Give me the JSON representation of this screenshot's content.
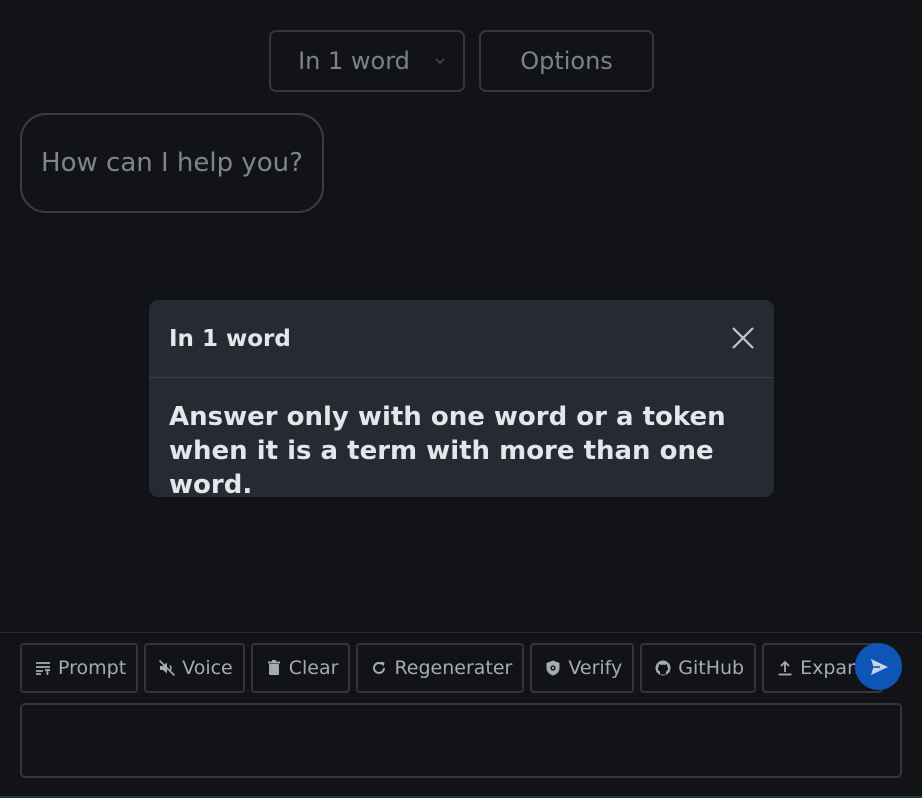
{
  "header": {
    "mode_select": {
      "value": "In 1 word"
    },
    "options_label": "Options"
  },
  "chat": {
    "greeting": "How can I help you?"
  },
  "modal": {
    "title": "In 1 word",
    "body": "Answer only with one word or a token when it is a term with more than one word."
  },
  "toolbar": {
    "buttons": [
      {
        "label": "Prompt",
        "icon": "prompt-icon"
      },
      {
        "label": "Voice",
        "icon": "voice-off-icon"
      },
      {
        "label": "Clear",
        "icon": "trash-icon"
      },
      {
        "label": "Regenerater",
        "icon": "refresh-icon"
      },
      {
        "label": "Verify",
        "icon": "shield-icon"
      },
      {
        "label": "GitHub",
        "icon": "github-icon"
      },
      {
        "label": "Expand",
        "icon": "upload-icon"
      }
    ],
    "send_icon": "send-icon"
  },
  "input": {
    "value": "",
    "placeholder": ""
  },
  "colors": {
    "background": "#121316",
    "modal_bg": "#262a32",
    "accent": "#0f55b8"
  }
}
